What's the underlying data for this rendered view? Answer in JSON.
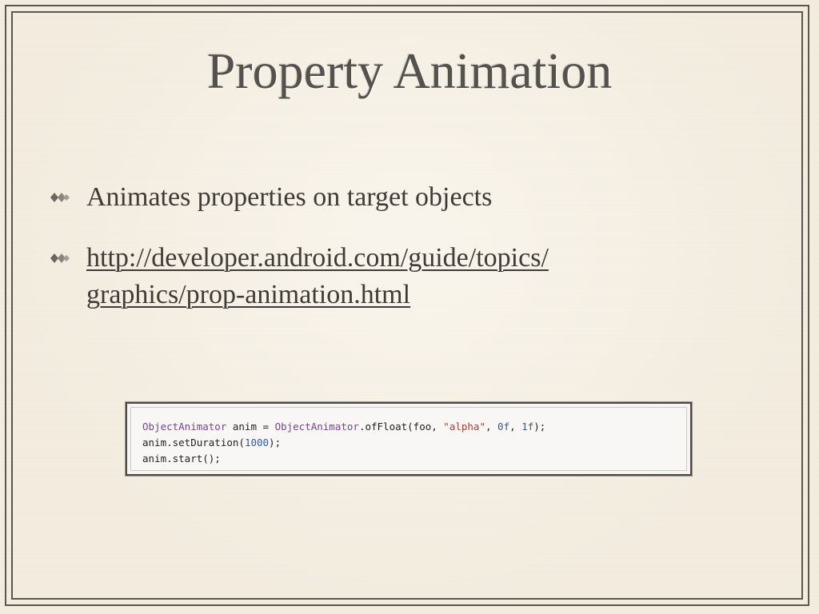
{
  "slide": {
    "title": "Property Animation",
    "bullets": [
      {
        "text": "Animates properties on target objects"
      },
      {
        "text": "http://developer.android.com/guide/topics/graphics/prop-animation.html",
        "line1": "http://developer.android.com/guide/topics/",
        "line2": "graphics/prop-animation.html"
      }
    ],
    "code": {
      "line1": {
        "t1": "ObjectAnimator",
        "t2": " anim = ",
        "t3": "ObjectAnimator",
        "t4": ".ofFloat(foo, ",
        "t5": "\"alpha\"",
        "t6": ", ",
        "t7": "0f",
        "t8": ", ",
        "t9": "1f",
        "t10": ");"
      },
      "line2": {
        "t1": "anim.setDuration(",
        "t2": "1000",
        "t3": ");"
      },
      "line3": {
        "t1": "anim.start();"
      }
    }
  }
}
